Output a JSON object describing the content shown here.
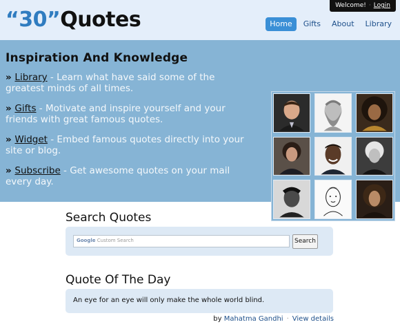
{
  "userbar": {
    "welcome": "Welcome!",
    "separator": "·",
    "login": "Login"
  },
  "logo": {
    "number": "“30”",
    "word": "Quotes"
  },
  "nav": [
    {
      "label": "Home",
      "active": true
    },
    {
      "label": "Gifts",
      "active": false
    },
    {
      "label": "About",
      "active": false
    },
    {
      "label": "Library",
      "active": false
    }
  ],
  "banner": {
    "title": "Inspiration And Knowledge",
    "features": [
      {
        "link": "Library",
        "text": " - Learn what have said some of the greatest minds of all times."
      },
      {
        "link": "Gifts",
        "text": " - Motivate and inspire yourself and your friends with great famous quotes."
      },
      {
        "link": "Widget",
        "text": " - Embed famous quotes directly into your site or blog."
      },
      {
        "link": "Subscribe",
        "text": " - Get awesome quotes on your mail every day."
      }
    ]
  },
  "search": {
    "title": "Search Quotes",
    "google_label": "Google",
    "placeholder": "Custom Search",
    "button": "Search"
  },
  "qotd": {
    "title": "Quote Of The Day",
    "quote": "An eye for an eye will only make the whole world blind.",
    "by": "by",
    "author": "Mahatma Gandhi",
    "separator": "·",
    "details": "View details"
  },
  "colors": {
    "header_bg": "#e4eefa",
    "banner_bg": "#86b4d5",
    "accent": "#3a8fd6",
    "box_bg": "#dde9f5"
  }
}
